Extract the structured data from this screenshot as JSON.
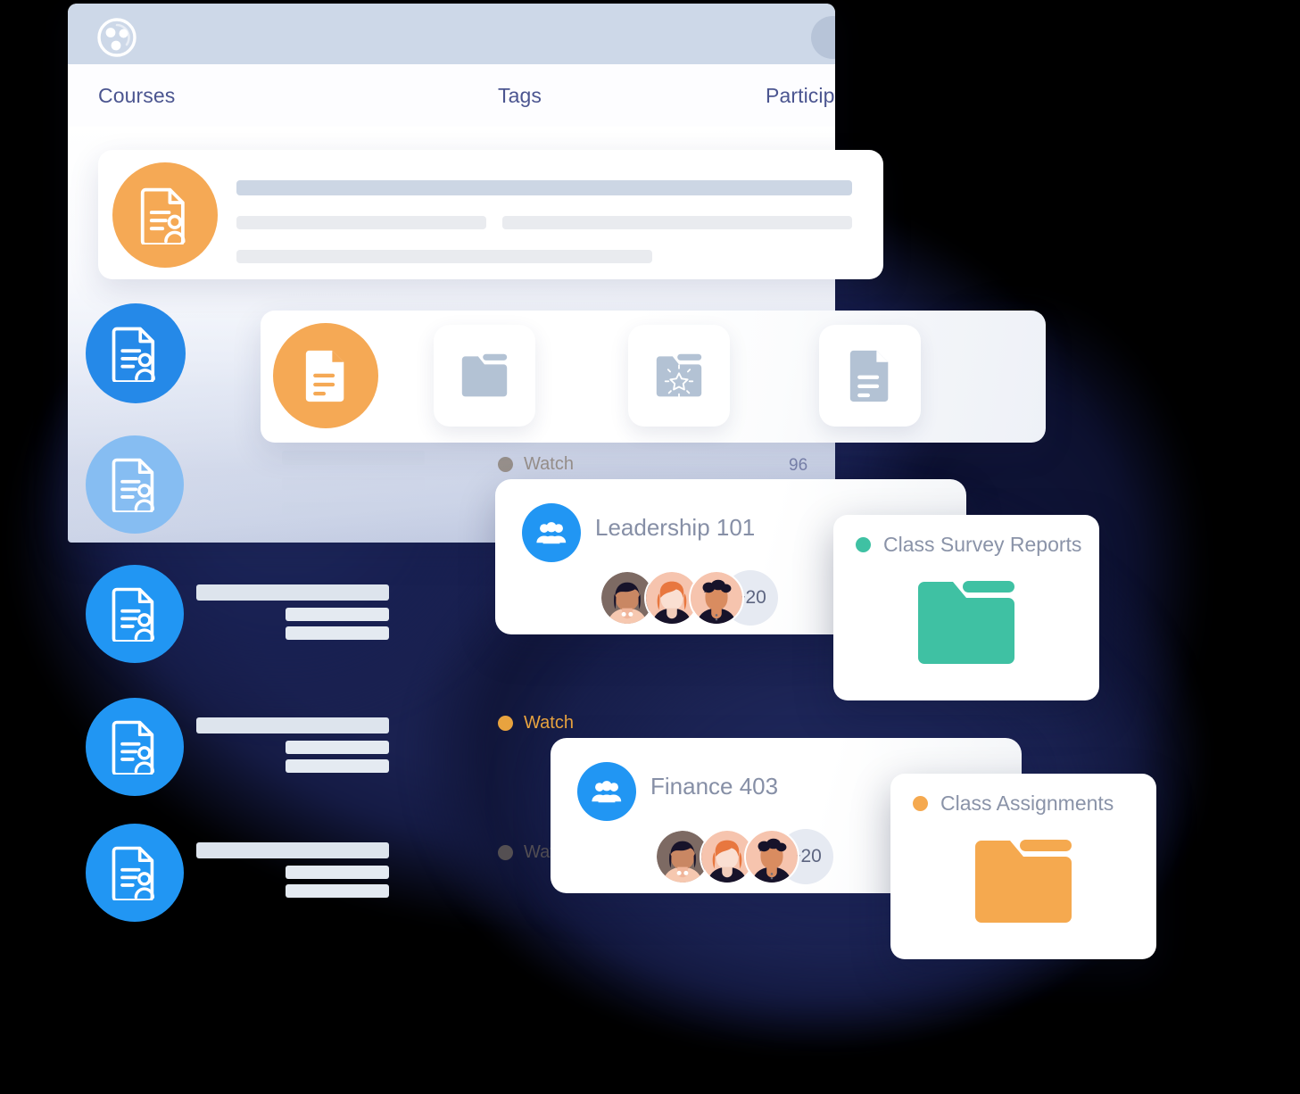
{
  "app": {
    "logo_icon": "pinwheel-logo-icon",
    "header_avatar_icon": "avatar-placeholder",
    "header_bar": "name-placeholder-bar"
  },
  "tabs": [
    {
      "label": "Courses",
      "name": "tab-courses"
    },
    {
      "label": "Tags",
      "name": "tab-tags"
    },
    {
      "label": "Participants",
      "name": "tab-participants"
    }
  ],
  "document_card": {
    "icon": "document-user-icon",
    "icon_color": "#f5a955"
  },
  "file_types": [
    {
      "name": "document-icon-active",
      "icon": "document-icon",
      "color": "#f5a955",
      "active": true
    },
    {
      "name": "folder-icon",
      "icon": "folder-icon",
      "color": "#b3c2d4",
      "active": false
    },
    {
      "name": "starred-folder-icon",
      "icon": "folder-star-icon",
      "color": "#b3c2d4",
      "active": false
    },
    {
      "name": "file-document-icon",
      "icon": "document-lines-icon",
      "color": "#b3c2d4",
      "active": false
    }
  ],
  "rail_icons": [
    {
      "name": "doc-user-icon-1",
      "color": "#1f8ceb",
      "opacity": 1
    },
    {
      "name": "doc-user-icon-2",
      "color": "#85bdf1",
      "opacity": 1
    },
    {
      "name": "doc-user-icon-3",
      "color": "#2196f3",
      "opacity": 1
    },
    {
      "name": "doc-user-icon-4",
      "color": "#2196f3",
      "opacity": 1
    },
    {
      "name": "doc-user-icon-5",
      "color": "#2196f3",
      "opacity": 1
    }
  ],
  "watch_rows": [
    {
      "label": "Watch",
      "count": "96",
      "dot_color": "#7b6a55"
    },
    {
      "label": "Watch",
      "count": "",
      "dot_color": "#e8a33f"
    },
    {
      "label": "Watch",
      "count": "",
      "dot_color": "#8c7f66"
    }
  ],
  "courses": [
    {
      "title": "Leadership 101",
      "icon": "group-people-icon",
      "icon_color": "#2196f3",
      "more_count": "+20",
      "avatars": [
        "avatar-dark-bob",
        "avatar-red-hair",
        "avatar-curly-dark"
      ]
    },
    {
      "title": "Finance 403",
      "icon": "group-people-icon",
      "icon_color": "#2196f3",
      "more_count": "+20",
      "avatars": [
        "avatar-dark-bob",
        "avatar-red-hair",
        "avatar-curly-dark"
      ]
    }
  ],
  "folders": [
    {
      "label": "Class Survey Reports",
      "color": "#3fc1a3",
      "dot_color": "#3fc1a3",
      "icon": "folder-icon"
    },
    {
      "label": "Class Assignments",
      "color": "#f5a94f",
      "dot_color": "#f5a94f",
      "icon": "folder-icon"
    }
  ],
  "colors": {
    "accent_blue": "#2196f3",
    "accent_orange": "#f5a955",
    "accent_green": "#3fc1a3",
    "tab_text": "#4b5590",
    "background_dark": "#1a2150"
  }
}
